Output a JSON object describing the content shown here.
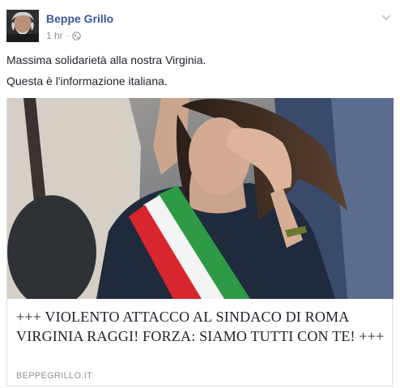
{
  "post": {
    "author": "Beppe Grillo",
    "timestamp": "1 hr",
    "separator": "·",
    "privacy_icon": "globe-icon",
    "options_icon": "chevron-down-icon",
    "text_lines": [
      "Massima solidarietà alla nostra Virginia.",
      "Questa è l'informazione italiana."
    ]
  },
  "link_card": {
    "title": "+++ VIOLENTO ATTACCO AL SINDACO DI ROMA VIRGINIA RAGGI! FORZA: SIAMO TUTTI CON TE! +++",
    "domain": "BEPPEGRILLO.IT"
  },
  "colors": {
    "author_link": "#365899",
    "meta_gray": "#90949c",
    "text": "#1d2129",
    "border": "#dddfe2",
    "sash_green": "#2e9a45",
    "sash_white": "#f4f4f4",
    "sash_red": "#d8262e"
  }
}
